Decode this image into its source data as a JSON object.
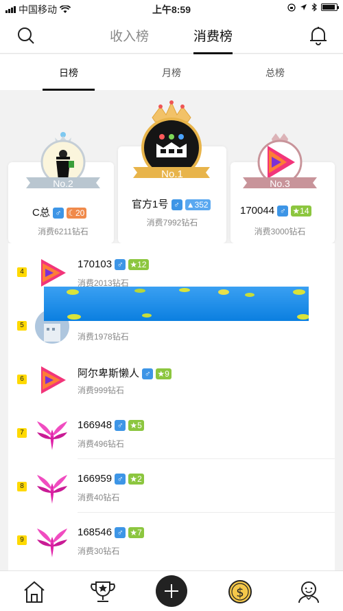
{
  "status_bar": {
    "carrier": "中国移动",
    "time": "上午8:59"
  },
  "header": {
    "tabs": [
      "收入榜",
      "消费榜"
    ],
    "active_tab": "消费榜"
  },
  "sub_tabs": {
    "items": [
      "日榜",
      "月榜",
      "总榜"
    ],
    "active": "日榜"
  },
  "podium": {
    "first": {
      "badge": "No.1",
      "name": "官方1号",
      "level": "352",
      "spend": "消费7992钻石"
    },
    "second": {
      "badge": "No.2",
      "name": "C总",
      "level": "20",
      "spend": "消费6211钻石"
    },
    "third": {
      "badge": "No.3",
      "name": "170044",
      "level": "14",
      "spend": "消费3000钻石"
    }
  },
  "list": [
    {
      "rank": "4",
      "name": "170103",
      "level": "12",
      "spend": "消费2013钻石"
    },
    {
      "rank": "5",
      "name": "",
      "level": "",
      "spend": "消费1978钻石"
    },
    {
      "rank": "6",
      "name": "阿尔卑斯懒人",
      "level": "9",
      "spend": "消费999钻石"
    },
    {
      "rank": "7",
      "name": "166948",
      "level": "5",
      "spend": "消费496钻石"
    },
    {
      "rank": "8",
      "name": "166959",
      "level": "2",
      "spend": "消费40钻石"
    },
    {
      "rank": "9",
      "name": "168546",
      "level": "7",
      "spend": "消费30钻石"
    }
  ],
  "gender_symbol": "♂",
  "colors": {
    "gold": "#e8b44a",
    "silver": "#b9c6d0",
    "bronze": "#c8949a",
    "rank_badge": "#ffd900",
    "gender": "#3d95e6",
    "level_green": "#8cc63f"
  },
  "bottom_nav_icons": [
    "home-icon",
    "trophy-icon",
    "add-icon",
    "coin-icon",
    "profile-icon"
  ]
}
